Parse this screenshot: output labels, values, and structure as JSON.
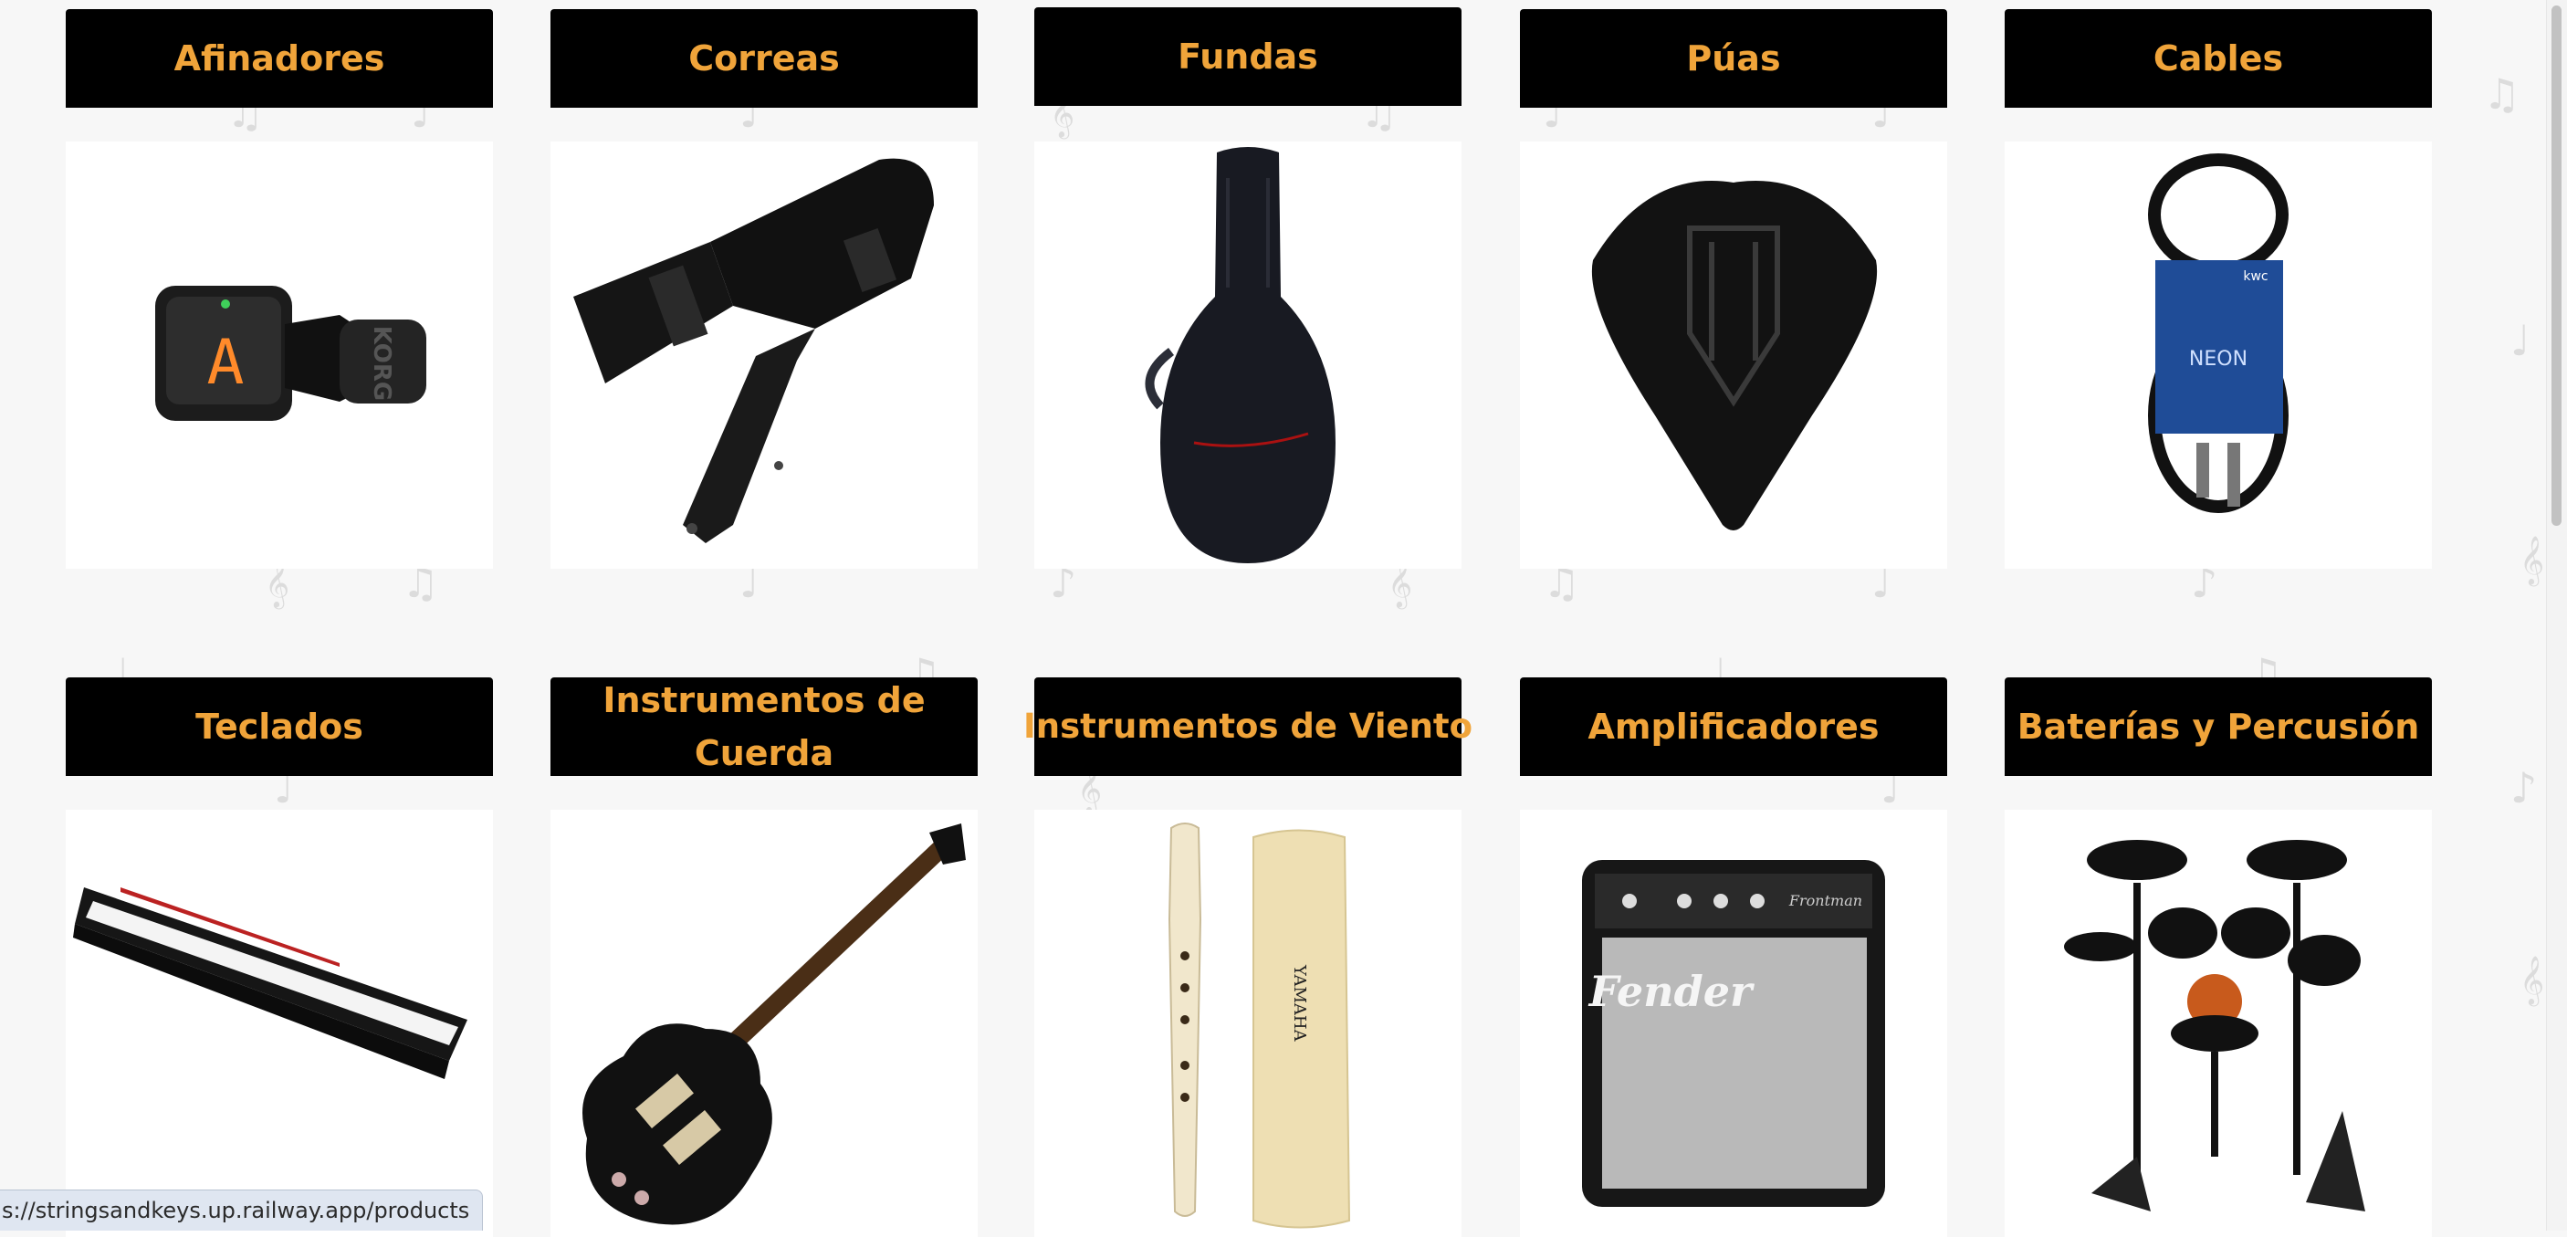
{
  "categories": [
    {
      "label": "Afinadores",
      "icon": "clip-tuner-image"
    },
    {
      "label": "Correas",
      "icon": "guitar-strap-image"
    },
    {
      "label": "Fundas",
      "icon": "gig-bag-image"
    },
    {
      "label": "Púas",
      "icon": "guitar-pick-image"
    },
    {
      "label": "Cables",
      "icon": "coiled-cable-image"
    },
    {
      "label": "Teclados",
      "icon": "digital-keyboard-image"
    },
    {
      "label": "Instrumentos de Cuerda",
      "icon": "electric-guitar-image"
    },
    {
      "label": "Instrumentos de Viento",
      "icon": "recorder-image"
    },
    {
      "label": "Amplificadores",
      "icon": "guitar-amp-image"
    },
    {
      "label": "Baterías y Percusión",
      "icon": "electronic-drum-kit-image"
    }
  ],
  "product_brand_text": {
    "tuner_display": "A",
    "tuner_brand": "KORG",
    "cable_brand": "NEON",
    "cable_maker": "kwc",
    "recorder_brand": "YAMAHA",
    "amp_brand": "Fender",
    "amp_model": "Frontman"
  },
  "status_bar": {
    "url": "s://stringsandkeys.up.railway.app/products"
  },
  "colors": {
    "header_bg": "#000000",
    "header_text": "#f0a43a",
    "page_bg": "#f7f7f7"
  }
}
